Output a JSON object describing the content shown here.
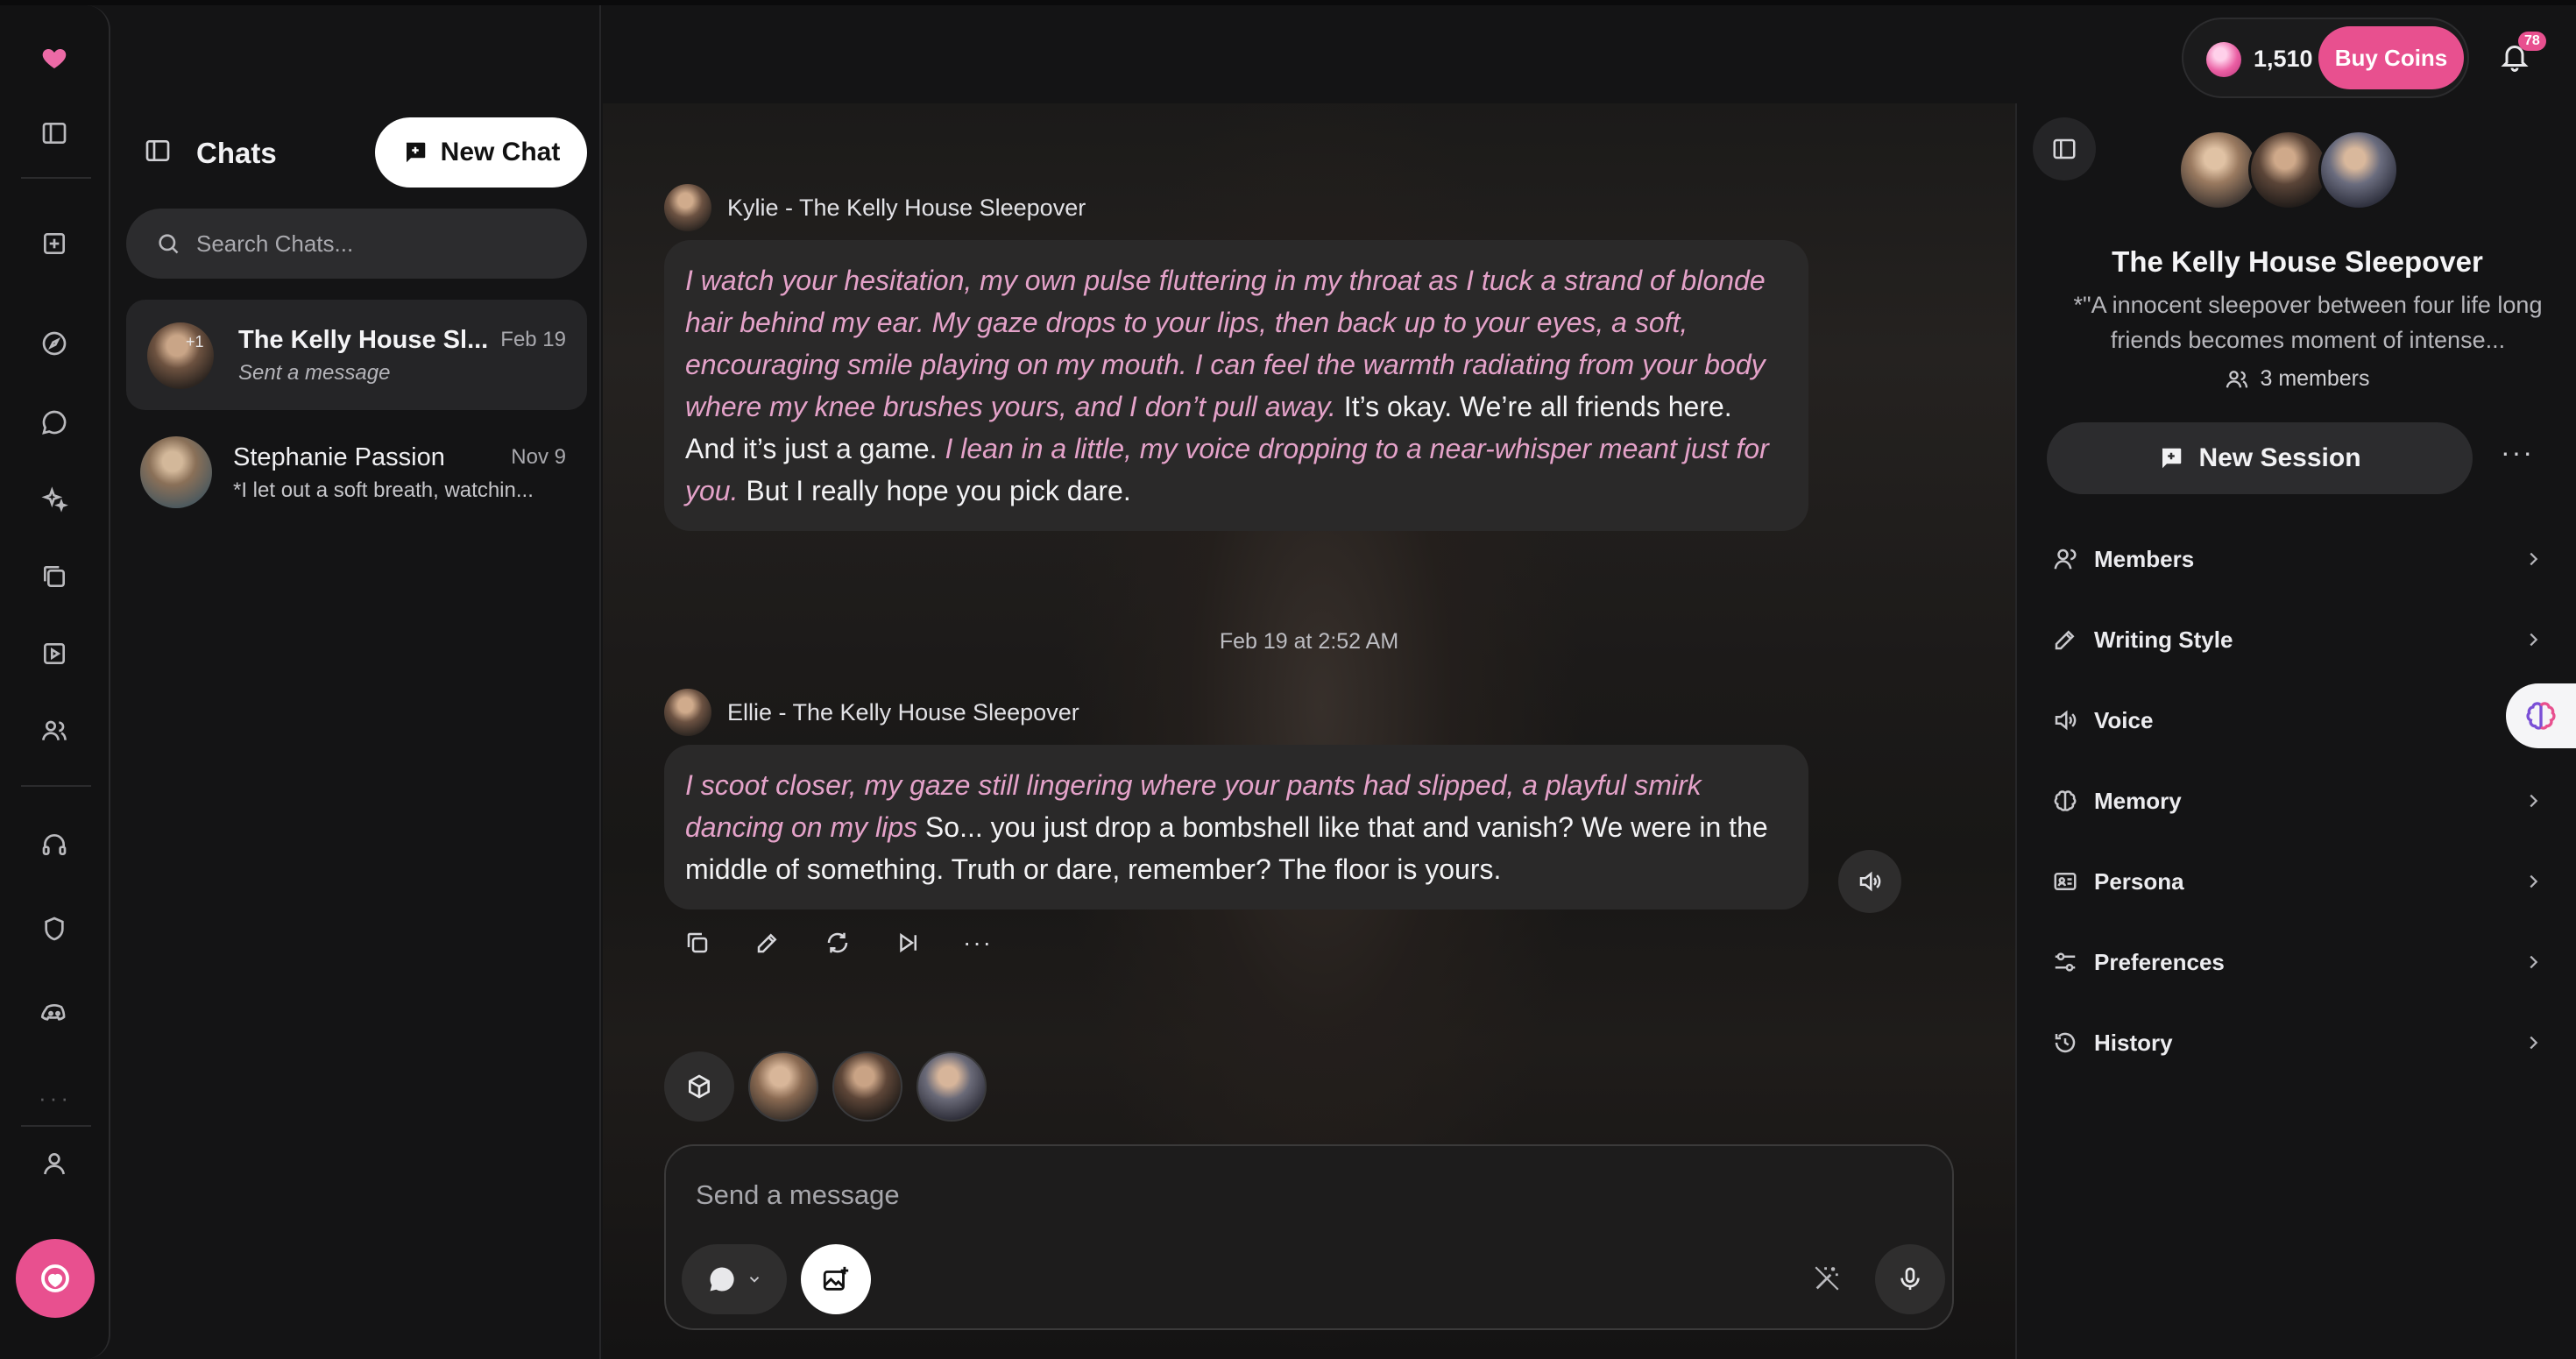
{
  "rail": {
    "icons": [
      "heart-logo-icon",
      "sidebar-toggle-icon",
      "add-square-icon",
      "compass-icon",
      "chat-bubble-icon",
      "sparkles-icon",
      "collection-icon",
      "video-play-icon",
      "users-icon",
      "headset-icon",
      "shield-icon",
      "discord-icon",
      "more-icon",
      "profile-icon",
      "create-fab-icon"
    ]
  },
  "chats": {
    "title": "Chats",
    "new_chat_label": "New Chat",
    "search_placeholder": "Search Chats...",
    "items": [
      {
        "name": "The Kelly House Sl...",
        "date": "Feb 19",
        "preview": "Sent a message",
        "extra": "+1"
      },
      {
        "name": "Stephanie Passion",
        "date": "Nov 9",
        "preview": "*I let out a soft breath, watchin..."
      }
    ]
  },
  "header": {
    "coins": "1,510",
    "buy_coins_label": "Buy Coins",
    "notifications_badge": "78"
  },
  "conversation": {
    "messages": [
      {
        "sender": "Kylie - The Kelly House Sleepover",
        "parts": [
          {
            "italic": true,
            "text": "I watch your hesitation, my own pulse fluttering in my throat as I tuck a strand of blonde hair behind my ear. My gaze drops to your lips, then back up to your eyes, a soft, encouraging smile playing on my mouth. I can feel the warmth radiating from your body where my knee brushes yours, and I don’t pull away."
          },
          {
            "italic": false,
            "text": " It’s okay. We’re all friends here. And it’s just a game. "
          },
          {
            "italic": true,
            "text": "I lean in a little, my voice dropping to a near-whisper meant just for you."
          },
          {
            "italic": false,
            "text": " But I really hope you pick dare."
          }
        ]
      },
      {
        "sender": "Ellie - The Kelly House Sleepover",
        "parts": [
          {
            "italic": true,
            "text": "I scoot closer, my gaze still lingering where your pants had slipped, a playful smirk dancing on my lips"
          },
          {
            "italic": false,
            "text": " So... you just drop a bombshell like that and vanish? We were in the middle of something. Truth or dare, remember? The floor is yours."
          }
        ]
      }
    ],
    "timestamp": "Feb 19 at 2:52 AM",
    "composer_placeholder": "Send a message"
  },
  "panel": {
    "title": "The Kelly House Sleepover",
    "description": "*\"A innocent sleepover between four life long friends becomes moment of intense...",
    "members_count": "3 members",
    "new_session_label": "New Session",
    "menu": [
      {
        "label": "Members",
        "icon": "user-icon"
      },
      {
        "label": "Writing Style",
        "icon": "pencil-icon"
      },
      {
        "label": "Voice",
        "icon": "speaker-icon"
      },
      {
        "label": "Memory",
        "icon": "brain-icon"
      },
      {
        "label": "Persona",
        "icon": "id-card-icon"
      },
      {
        "label": "Preferences",
        "icon": "sliders-icon"
      },
      {
        "label": "History",
        "icon": "history-icon"
      }
    ]
  }
}
